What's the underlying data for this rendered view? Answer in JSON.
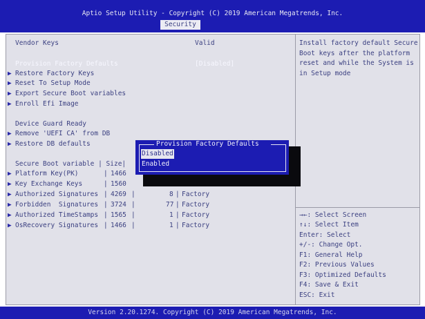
{
  "header": {
    "title": "Aptio Setup Utility - Copyright (C) 2019 American Megatrends, Inc.",
    "tab": "Security"
  },
  "left": {
    "vendor_keys_label": "Vendor Keys",
    "vendor_keys_value": "Valid",
    "provision_label": "Provision Factory Defaults",
    "provision_value": "[Disabled]",
    "arrow_glyph": "▶",
    "menu_items": [
      "Restore Factory Keys",
      "Reset To Setup Mode",
      "Export Secure Boot variables",
      "Enroll Efi Image"
    ],
    "device_guard_label": "Device Guard Ready",
    "device_guard_items": [
      "Remove 'UEFI CA' from DB",
      "Restore DB defaults"
    ],
    "table": {
      "header": "Secure Boot variable | Size|",
      "rows": [
        {
          "name": "Platform Key(PK)",
          "size": "1466",
          "keys": "",
          "source": ""
        },
        {
          "name": "Key Exchange Keys",
          "size": "1560",
          "keys": "",
          "source": ""
        },
        {
          "name": "Authorized Signatures",
          "size": "4269",
          "keys": "8",
          "source": "Factory"
        },
        {
          "name": "Forbidden  Signatures",
          "size": "3724",
          "keys": "77",
          "source": "Factory"
        },
        {
          "name": "Authorized TimeStamps",
          "size": "1565",
          "keys": "1",
          "source": "Factory"
        },
        {
          "name": "OsRecovery Signatures",
          "size": "1466",
          "keys": "1",
          "source": "Factory"
        }
      ]
    }
  },
  "help": {
    "text": "Install factory default Secure Boot keys after the platform reset and while the System is in Setup mode"
  },
  "keys": [
    "→←: Select Screen",
    "↑↓: Select Item",
    "Enter: Select",
    "+/-: Change Opt.",
    "F1: General Help",
    "F2: Previous Values",
    "F3: Optimized Defaults",
    "F4: Save & Exit",
    "ESC: Exit"
  ],
  "dialog": {
    "title": "Provision Factory Defaults",
    "options": [
      "Disabled",
      "Enabled"
    ],
    "selected": "Disabled"
  },
  "footer": {
    "text": "Version 2.20.1274. Copyright (C) 2019 American Megatrends, Inc."
  },
  "colors": {
    "title_bar": "#1c1cb2",
    "panel": "#e1e1e9",
    "text": "#3a3f80",
    "highlight": "#f7f7ff"
  }
}
